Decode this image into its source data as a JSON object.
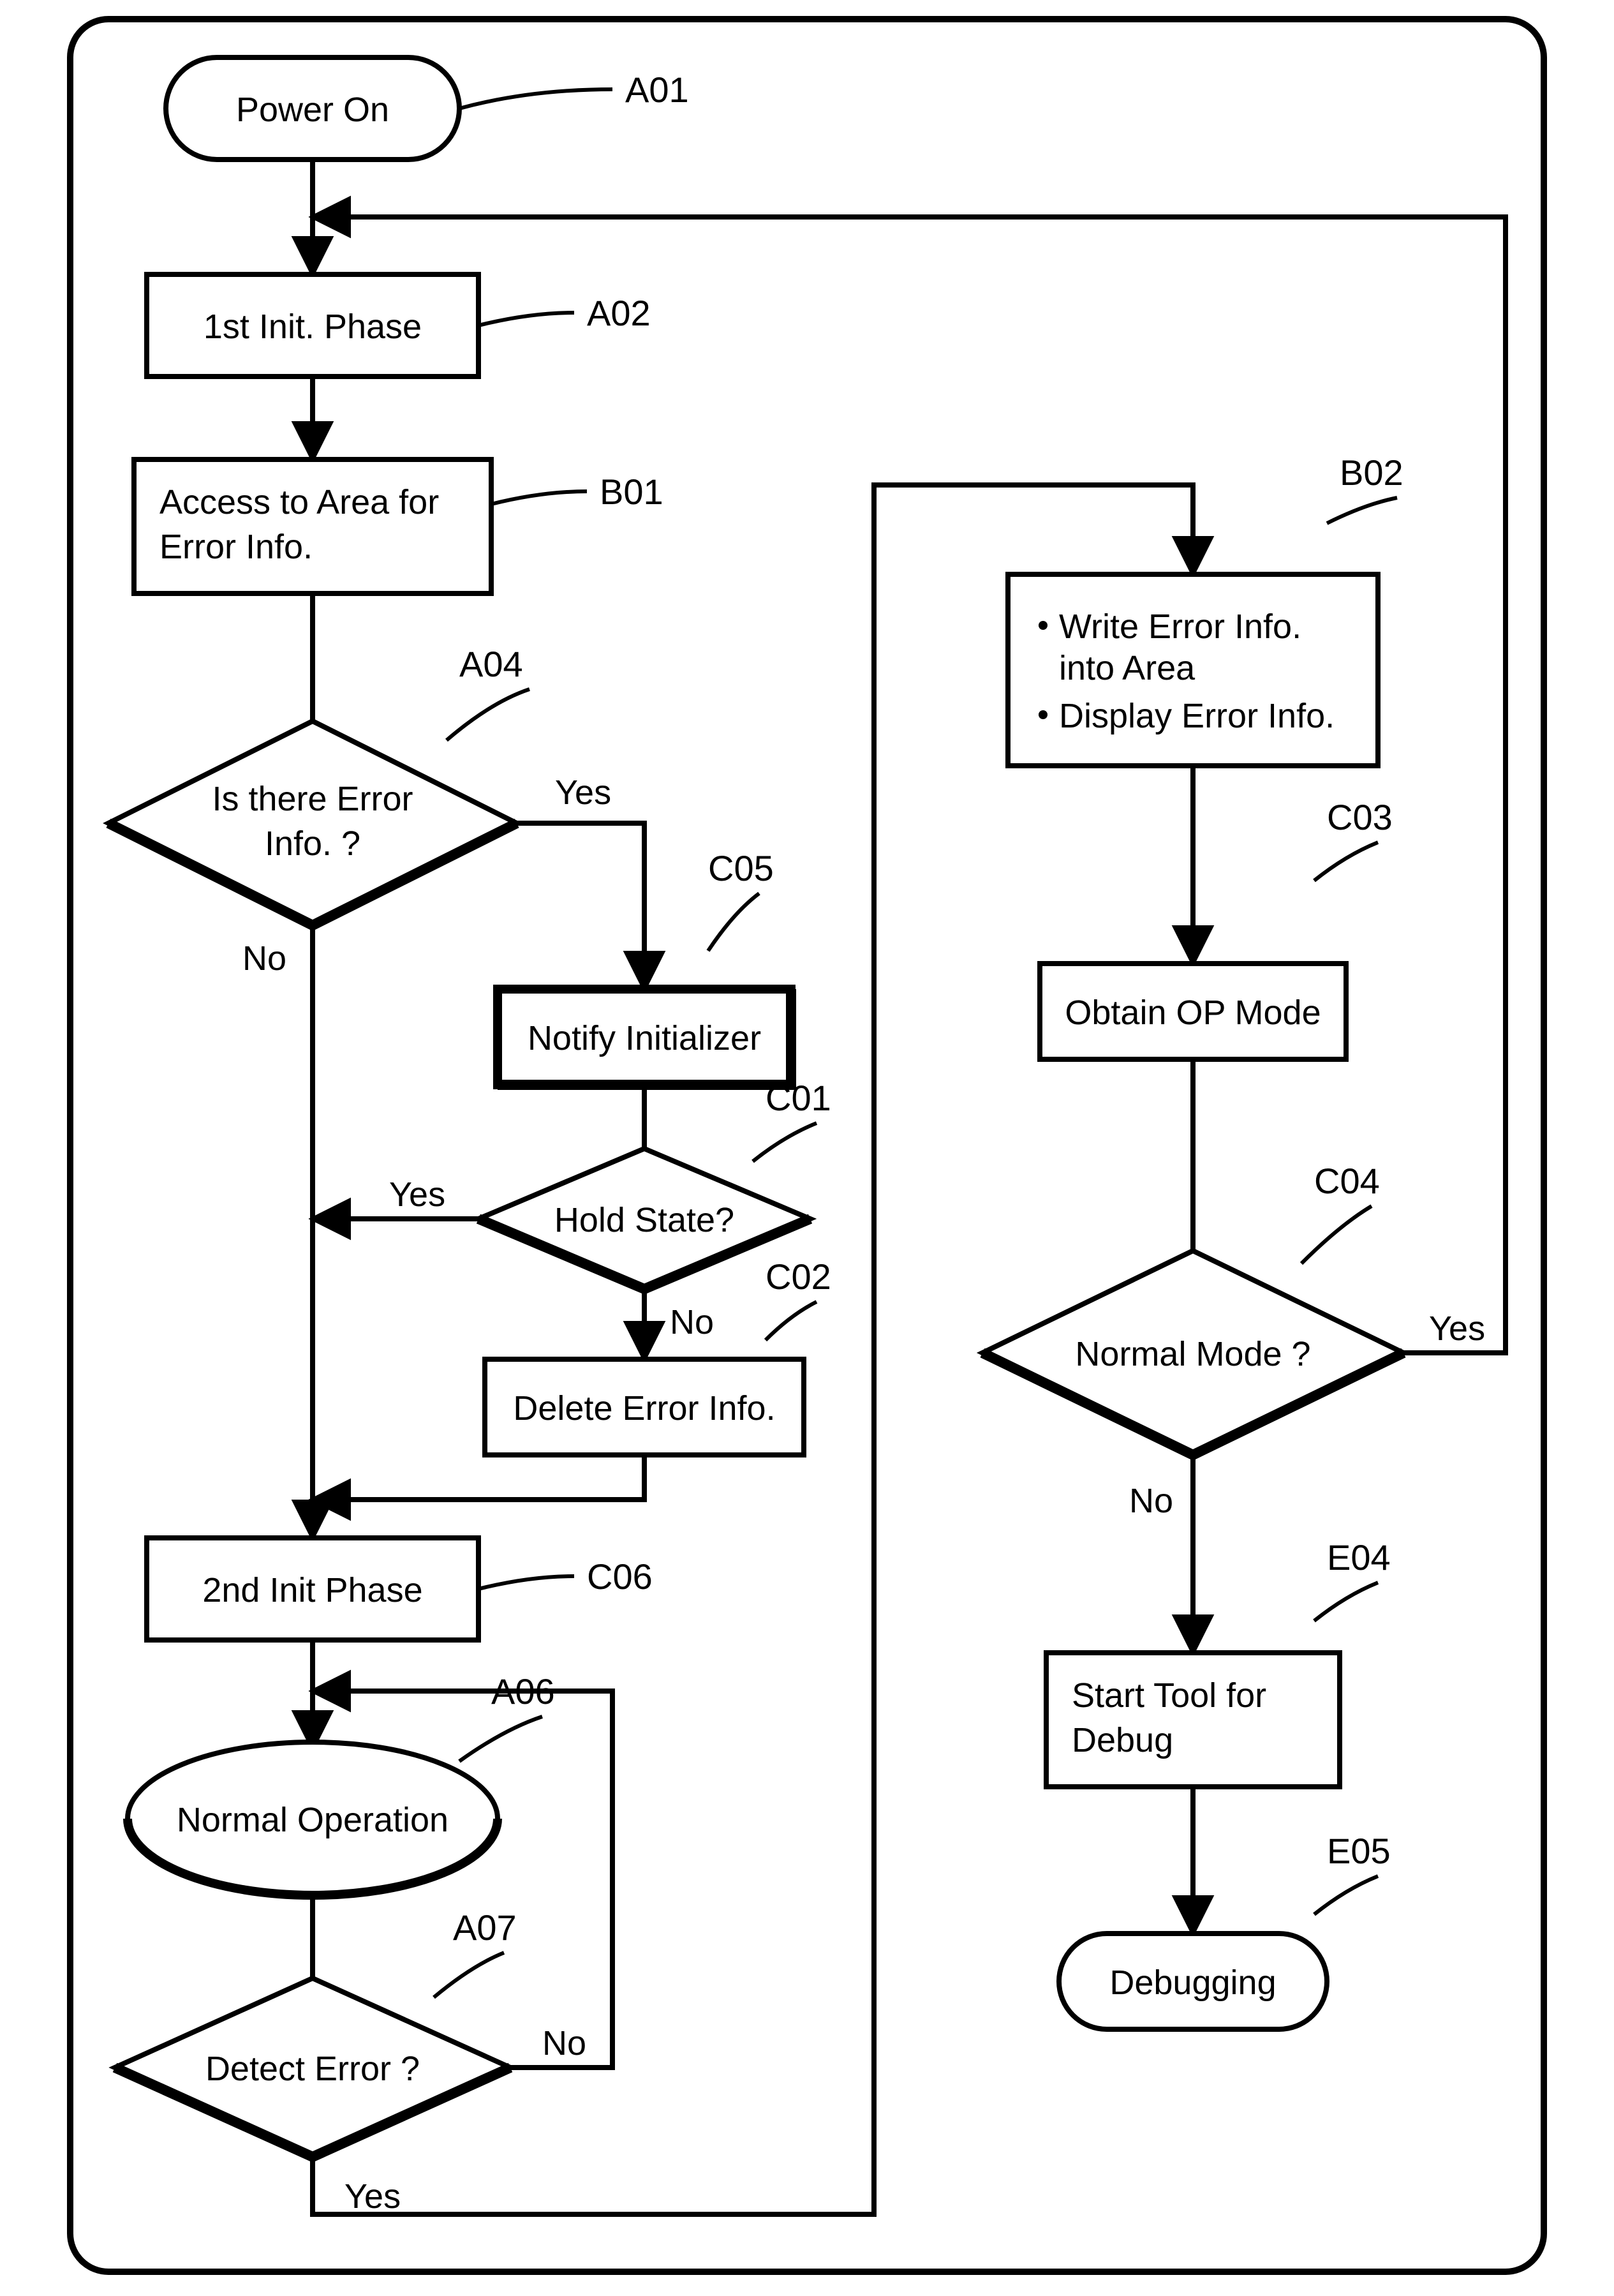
{
  "nodes": {
    "A01": {
      "tag": "A01",
      "text": [
        "Power On"
      ]
    },
    "A02": {
      "tag": "A02",
      "text": [
        "1st Init. Phase"
      ]
    },
    "B01": {
      "tag": "B01",
      "text": [
        "Access to Area for",
        "Error Info."
      ]
    },
    "A04": {
      "tag": "A04",
      "text": [
        "Is there Error",
        "Info. ?"
      ],
      "yes": "Yes",
      "no": "No"
    },
    "C05": {
      "tag": "C05",
      "text": [
        "Notify Initializer"
      ]
    },
    "C01": {
      "tag": "C01",
      "text": [
        "Hold State?"
      ],
      "yes": "Yes",
      "no": "No"
    },
    "C02": {
      "tag": "C02",
      "text": [
        "Delete Error Info."
      ]
    },
    "C06": {
      "tag": "C06",
      "text": [
        "2nd Init Phase"
      ]
    },
    "A06": {
      "tag": "A06",
      "text": [
        "Normal Operation"
      ]
    },
    "A07": {
      "tag": "A07",
      "text": [
        "Detect Error ?"
      ],
      "yes": "Yes",
      "no": "No"
    },
    "B02": {
      "tag": "B02",
      "text": [
        "Write Error Info.",
        "into Area",
        "Display Error Info."
      ]
    },
    "C03": {
      "tag": "C03",
      "text": [
        "Obtain OP Mode"
      ]
    },
    "C04": {
      "tag": "C04",
      "text": [
        "Normal Mode ?"
      ],
      "yes": "Yes",
      "no": "No"
    },
    "E04": {
      "tag": "E04",
      "text": [
        "Start Tool for",
        "Debug"
      ]
    },
    "E05": {
      "tag": "E05",
      "text": [
        "Debugging"
      ]
    }
  }
}
